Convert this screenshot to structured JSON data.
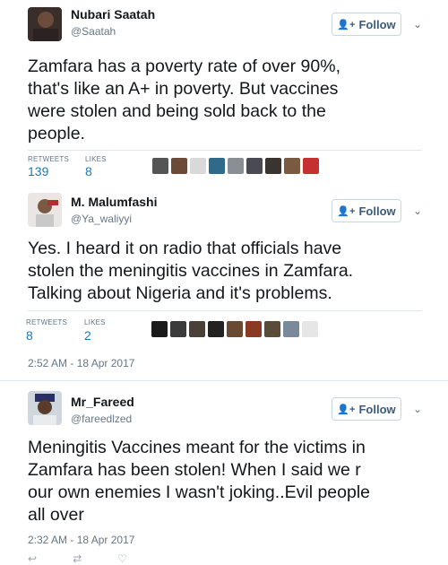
{
  "follow_label": "Follow",
  "tweets": [
    {
      "name": "Nubari Saatah",
      "handle": "@Saatah",
      "lines": [
        "Zamfara has a poverty rate of over 90%,",
        "that's like an A+ in poverty. But vaccines",
        "were stolen and being sold back to the",
        "people."
      ],
      "retweets_label": "RETWEETS",
      "retweets": "139",
      "likes_label": "LIKES",
      "likes": "8"
    },
    {
      "name": "M. Malumfashi",
      "handle": "@Ya_waliyyi",
      "lines": [
        "Yes. I heard it on radio that officials have",
        "stolen the meningitis vaccines in Zamfara.",
        "Talking about Nigeria and it's problems."
      ],
      "retweets_label": "RETWEETS",
      "retweets": "8",
      "likes_label": "LIKES",
      "likes": "2",
      "timestamp": "2:52 AM - 18 Apr 2017"
    },
    {
      "name": "Mr_Fareed",
      "handle": "@fareedlzed",
      "lines": [
        "Meningitis Vaccines meant for the victims in",
        "Zamfara has been stolen! When I said we r",
        "our own enemies I wasn't joking..Evil people",
        "all over"
      ],
      "timestamp": "2:32 AM - 18 Apr 2017"
    }
  ],
  "colors": {
    "accent": "#1b7bb7",
    "muted": "#657786",
    "text": "#14171a"
  },
  "icons": {
    "follow": "add-person-icon",
    "caret": "chevron-down-icon"
  }
}
